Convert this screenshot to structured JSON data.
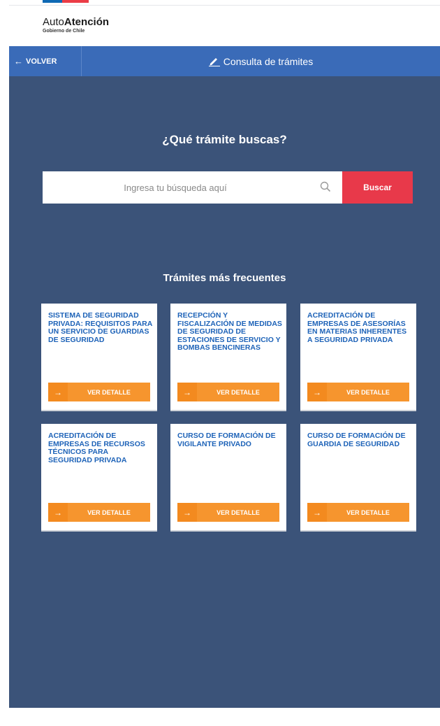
{
  "brand": {
    "name_light": "Auto",
    "name_bold": "Atención",
    "subtitle": "Gobierno de Chile"
  },
  "nav": {
    "back_label": "VOLVER",
    "title": "Consulta de trámites"
  },
  "search": {
    "heading": "¿Qué trámite buscas?",
    "placeholder": "Ingresa tu búsqueda aquí",
    "button_label": "Buscar"
  },
  "frequent": {
    "heading": "Trámites más frecuentes",
    "cards": [
      {
        "title": "SISTEMA DE SEGURIDAD PRIVADA: REQUISITOS PARA UN SERVICIO DE GUARDIAS DE SEGURIDAD",
        "button": "VER DETALLE"
      },
      {
        "title": "RECEPCIÓN Y FISCALIZACIÓN DE MEDIDAS DE SEGURIDAD DE ESTACIONES DE SERVICIO Y BOMBAS BENCINERAS",
        "button": "VER DETALLE"
      },
      {
        "title": "ACREDITACIÓN DE EMPRESAS DE ASESORÍAS EN MATERIAS INHERENTES A SEGURIDAD PRIVADA",
        "button": "VER DETALLE"
      },
      {
        "title": "ACREDITACIÓN DE EMPRESAS DE RECURSOS TÉCNICOS PARA SEGURIDAD PRIVADA",
        "button": "VER DETALLE"
      },
      {
        "title": "CURSO DE FORMACIÓN DE VIGILANTE PRIVADO",
        "button": "VER DETALLE"
      },
      {
        "title": "CURSO DE FORMACIÓN DE GUARDIA DE SEGURIDAD",
        "button": "VER DETALLE"
      }
    ]
  },
  "colors": {
    "nav": "#3a6bb8",
    "main_bg": "#3b5379",
    "search_button": "#e8394a",
    "card_button": "#f6952e",
    "card_title": "#1e63b8"
  }
}
